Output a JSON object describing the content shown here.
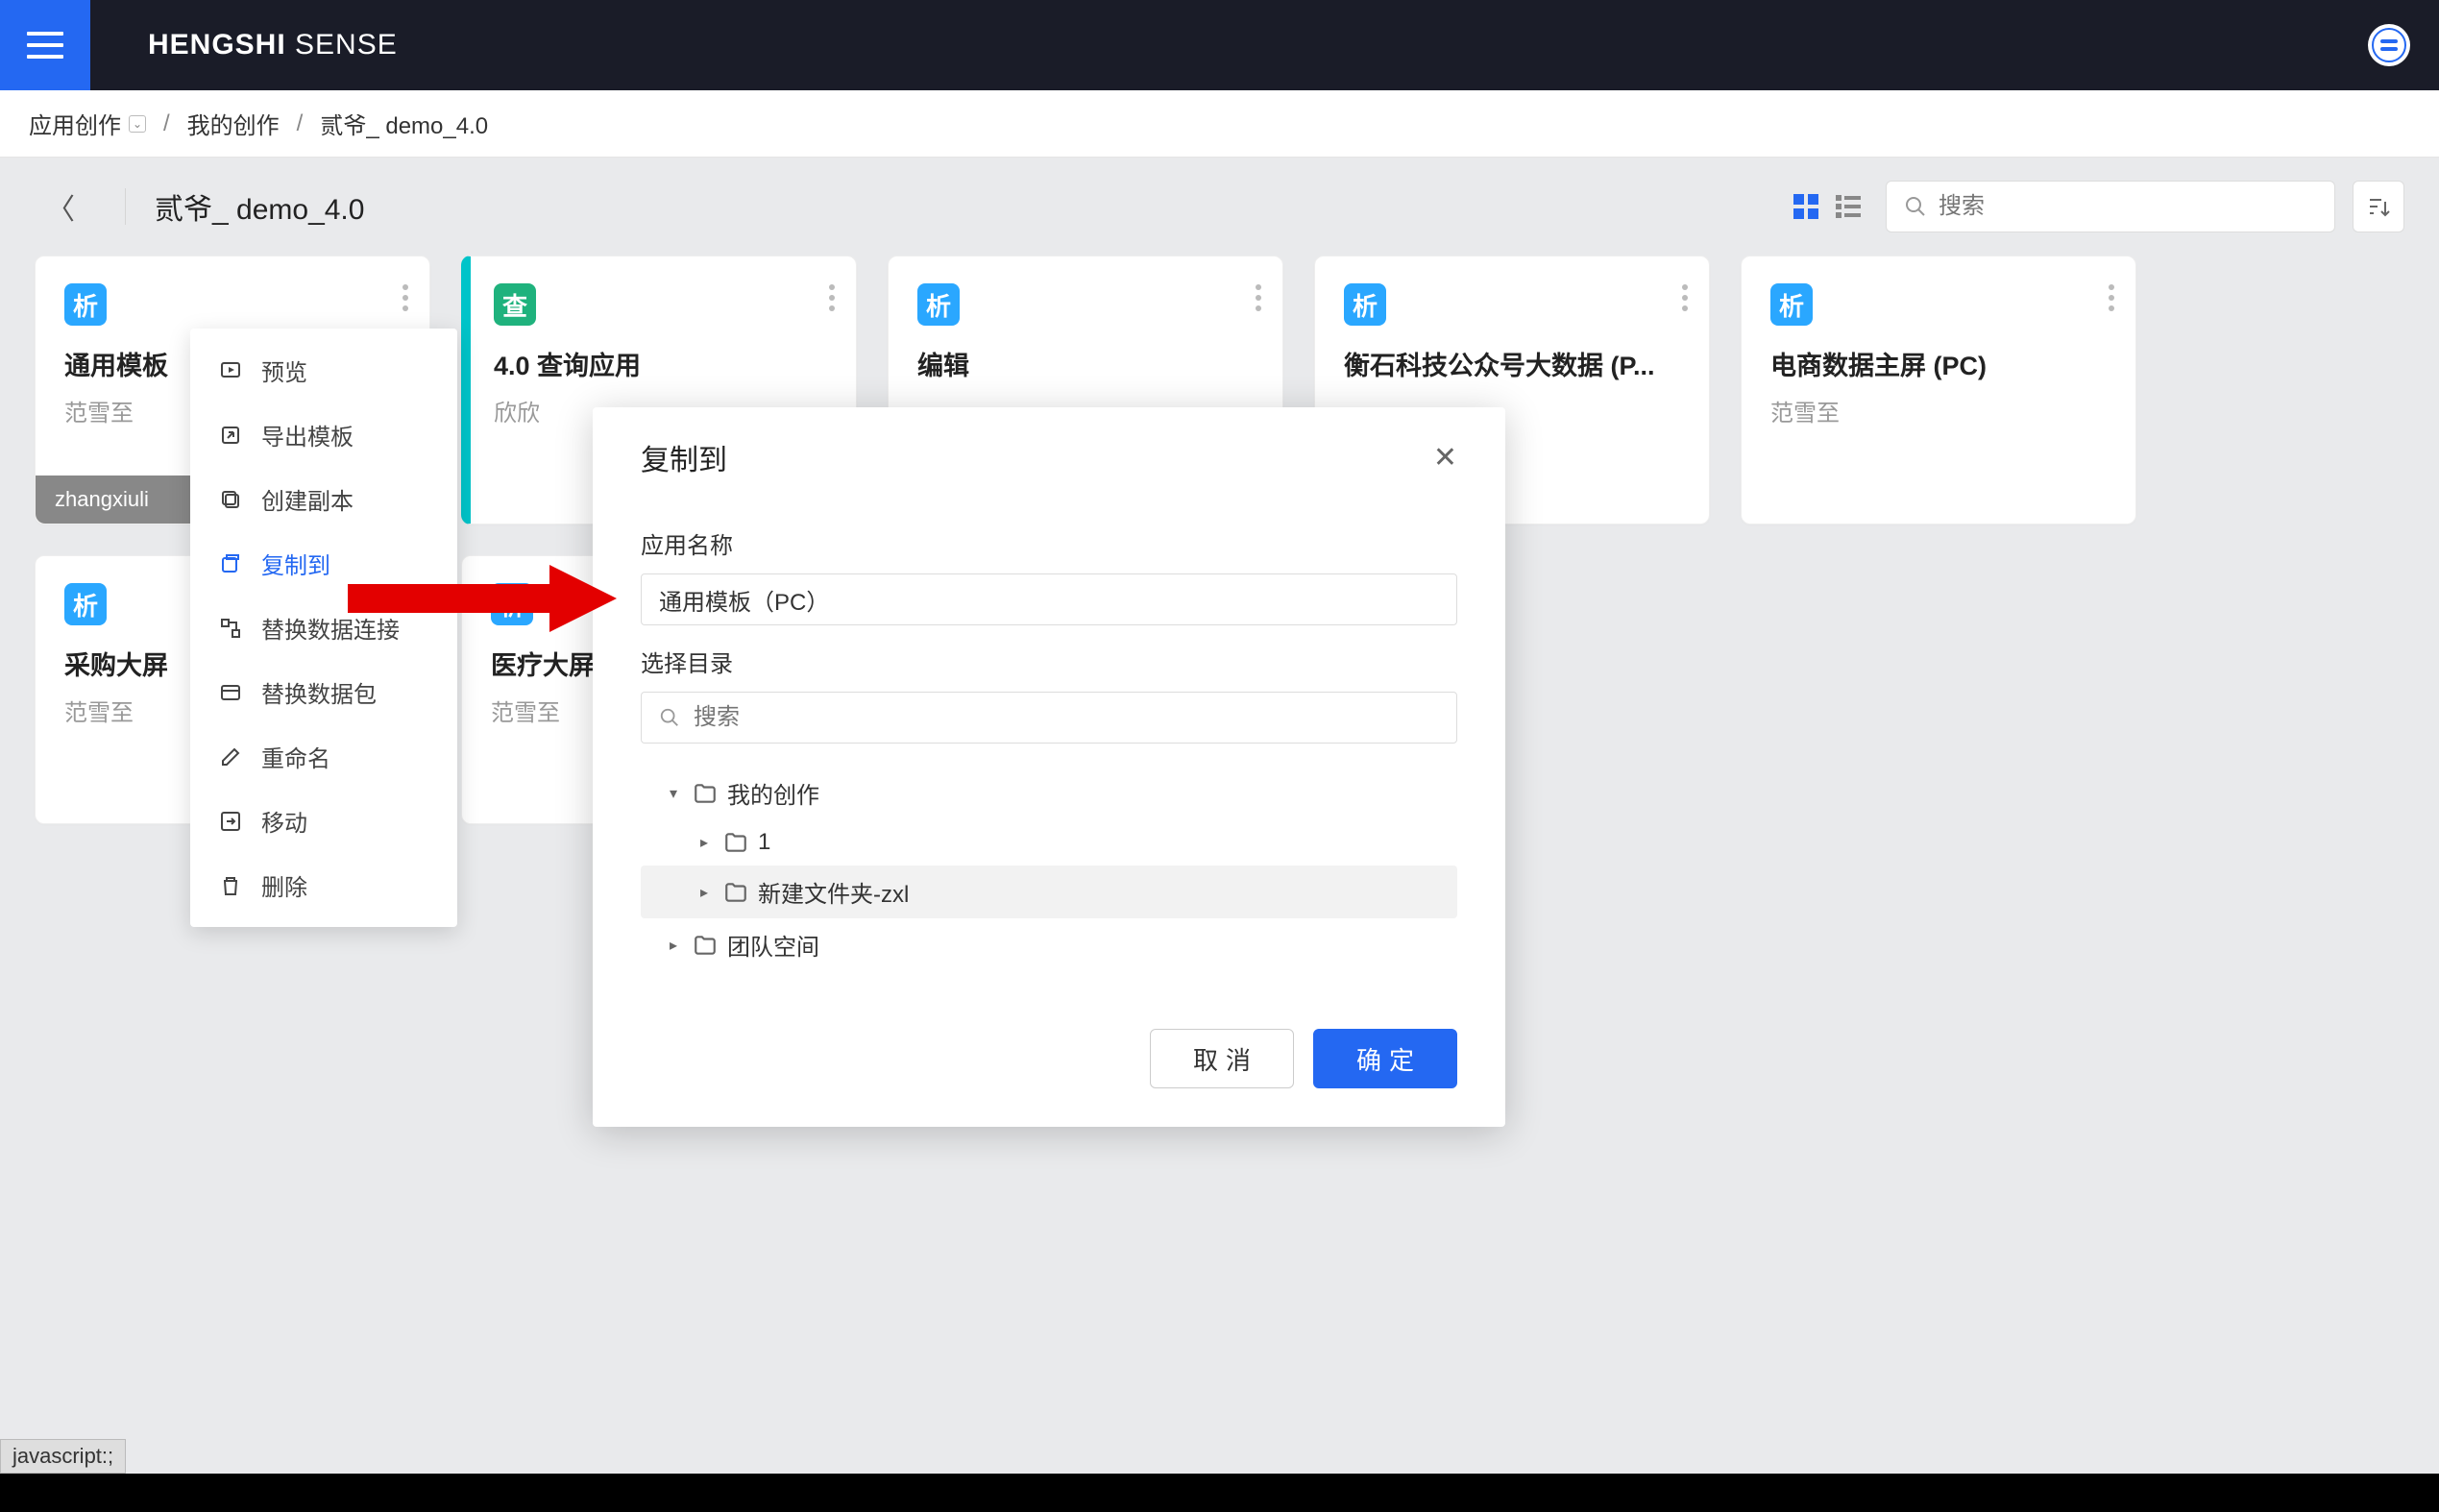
{
  "brand": {
    "bold": "HENGSHI",
    "light": "SENSE"
  },
  "breadcrumb": {
    "item1": "应用创作",
    "item2": "我的创作",
    "item3": "贰爷_ demo_4.0"
  },
  "page": {
    "title": "贰爷_ demo_4.0",
    "search_placeholder": "搜索"
  },
  "cards": {
    "row1": [
      {
        "badge": "析",
        "title": "通用模板",
        "sub": "范雪至",
        "lock": "zhangxiuli"
      },
      {
        "badge": "查",
        "title": "4.0 查询应用",
        "sub": "欣欣"
      },
      {
        "badge": "析",
        "title": "编辑",
        "sub": ""
      },
      {
        "badge": "析",
        "title": "衡石科技公众号大数据 (P...",
        "sub": ""
      },
      {
        "badge": "析",
        "title": "电商数据主屏 (PC)",
        "sub": "范雪至"
      }
    ],
    "row2": [
      {
        "badge": "析",
        "title": "采购大屏",
        "sub": "范雪至"
      },
      {
        "badge": "析",
        "title": "医疗大屏",
        "sub": "范雪至"
      }
    ]
  },
  "menu": {
    "preview": "预览",
    "export": "导出模板",
    "duplicate": "创建副本",
    "copyto": "复制到",
    "replace_conn": "替换数据连接",
    "replace_pkg": "替换数据包",
    "rename": "重命名",
    "move": "移动",
    "delete": "删除"
  },
  "modal": {
    "title": "复制到",
    "label_name": "应用名称",
    "name_value": "通用模板（PC）",
    "label_dir": "选择目录",
    "search_placeholder": "搜索",
    "tree": {
      "mywork": "我的创作",
      "folder1": "1",
      "folder2": "新建文件夹-zxl",
      "teamspace": "团队空间"
    },
    "cancel": "取消",
    "confirm": "确定"
  },
  "statusbar": {
    "js": "javascript:;"
  }
}
